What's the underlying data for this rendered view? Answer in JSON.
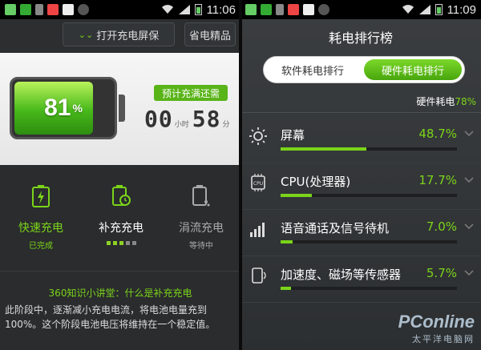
{
  "left": {
    "status": {
      "time": "11:06"
    },
    "screenlock_label": "打开充电屏保",
    "save_label": "省电精品",
    "battery_pct": 81,
    "battery_pct_text": "81",
    "pct_sign": "%",
    "need_label": "预计充满还需",
    "timer": {
      "hours": "00",
      "hours_unit": "小时",
      "minutes": "58",
      "minutes_unit": "分"
    },
    "modes": [
      {
        "name": "快速充电",
        "status": "已完成",
        "color": "#7bd41a"
      },
      {
        "name": "补充充电",
        "status": "",
        "color": "#ffffff"
      },
      {
        "name": "涓流充电",
        "status": "等待中",
        "color": "#aaaaaa"
      }
    ],
    "knowledge_title": "360知识小讲堂：什么是补充充电",
    "knowledge_body": "此阶段中，逐渐减小充电电流，将电池电量充到100%。这个阶段电池电压将维持在一个稳定值。"
  },
  "right": {
    "status": {
      "time": "11:09"
    },
    "title": "耗电排行榜",
    "tabs": [
      {
        "label": "软件耗电排行",
        "active": false
      },
      {
        "label": "硬件耗电排行",
        "active": true
      }
    ],
    "hw_total_label": "硬件耗电",
    "hw_total_pct": "78%",
    "items": [
      {
        "name": "屏幕",
        "pct_text": "48.7%",
        "pct": 48.7,
        "icon": "sun-icon"
      },
      {
        "name": "CPU(处理器)",
        "pct_text": "17.7%",
        "pct": 17.7,
        "icon": "cpu-icon"
      },
      {
        "name": "语音通话及信号待机",
        "pct_text": "7.0%",
        "pct": 7.0,
        "icon": "signal-icon"
      },
      {
        "name": "加速度、磁场等传感器",
        "pct_text": "5.7%",
        "pct": 5.7,
        "icon": "sensor-icon"
      }
    ]
  },
  "watermark": {
    "logo": "PConline",
    "sub": "太平洋电脑网"
  },
  "colors": {
    "accent": "#7bd41a"
  }
}
